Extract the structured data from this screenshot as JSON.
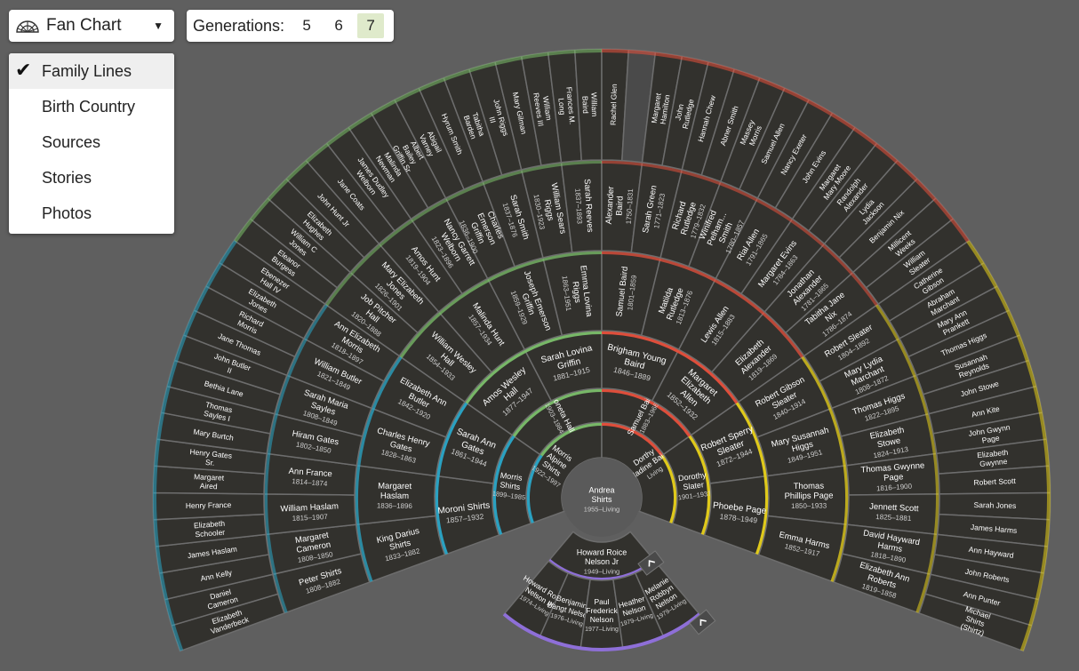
{
  "toolbar": {
    "chart_type": "Fan Chart",
    "generations_label": "Generations:",
    "generations": [
      "5",
      "6",
      "7"
    ],
    "selected_generation": "7"
  },
  "view_menu": {
    "items": [
      "Family Lines",
      "Birth Country",
      "Sources",
      "Stories",
      "Photos"
    ],
    "selected": "Family Lines"
  },
  "colors": {
    "background": "#5f5f5f",
    "slice": "#32312d",
    "paternal_paternal": "#7bbf6a",
    "paternal_maternal": "#2aa8c9",
    "maternal_paternal": "#e8503c",
    "maternal_maternal": "#e9d21a",
    "descendants": "#8e6fd8"
  },
  "focus_person": {
    "name": "Andrea Shirts",
    "dates": "1955–Living"
  },
  "ancestors": {
    "gen1": [
      {
        "name": "Morris Alpine Shirts",
        "dates": "1922–1997"
      },
      {
        "name": "Dorthy Madine Baird",
        "dates": "Living"
      }
    ],
    "gen2": [
      {
        "name": "Morris Shirts",
        "dates": "1899–1985"
      },
      {
        "name": "Loneta Hall",
        "dates": "1903–1984"
      },
      {
        "name": "Samuel Baird",
        "dates": "1883–1966"
      },
      {
        "name": "Dorothy Slater",
        "dates": "1901–1937"
      }
    ],
    "gen3": [
      {
        "name": "Moroni Shirts",
        "dates": "1857–1932"
      },
      {
        "name": "Sarah Ann Gates",
        "dates": "1861–1944"
      },
      {
        "name": "Amos Wesley Hall",
        "dates": "1877–1947"
      },
      {
        "name": "Sarah Lovina Griffin",
        "dates": "1881–1915"
      },
      {
        "name": "Brigham Young Baird",
        "dates": "1846–1889"
      },
      {
        "name": "Margaret Elizabeth Allen",
        "dates": "1852–1932"
      },
      {
        "name": "Robert Sperry Sleater",
        "dates": "1872–1944"
      },
      {
        "name": "Phoebe Page",
        "dates": "1878–1949"
      }
    ],
    "gen4": [
      {
        "name": "King Darius Shirts",
        "dates": "1833–1882"
      },
      {
        "name": "Margaret Haslam",
        "dates": "1836–1896"
      },
      {
        "name": "Charles Henry Gates",
        "dates": "1828–1863"
      },
      {
        "name": "Elizabeth Ann Butler",
        "dates": "1842–1920"
      },
      {
        "name": "William Wesley Hall",
        "dates": "1854–1933"
      },
      {
        "name": "Malinda Hunt",
        "dates": "1857–1934"
      },
      {
        "name": "Joseph Emerson Griffin",
        "dates": "1859–1929"
      },
      {
        "name": "Emma Lovina Riggs",
        "dates": "1863–1951"
      },
      {
        "name": "Samuel Baird",
        "dates": "1801–1859"
      },
      {
        "name": "Matilda Rutledge",
        "dates": "1813–1876"
      },
      {
        "name": "Lewis Allen",
        "dates": "1815–1883"
      },
      {
        "name": "Elizabeth Alexander",
        "dates": "1819–1869"
      },
      {
        "name": "Robert Gibson Sleater",
        "dates": "1840–1914"
      },
      {
        "name": "Mary Susannah Higgs",
        "dates": "1849–1951"
      },
      {
        "name": "Thomas Phillips Page",
        "dates": "1850–1933"
      },
      {
        "name": "Emma Harms",
        "dates": "1852–1917"
      }
    ],
    "gen5": [
      {
        "name": "Peter Shirts",
        "dates": "1808–1882"
      },
      {
        "name": "Margaret Cameron",
        "dates": "1808–1850"
      },
      {
        "name": "William Haslam",
        "dates": "1815–1907"
      },
      {
        "name": "Ann France",
        "dates": "1814–1874"
      },
      {
        "name": "Hiram Gates",
        "dates": "1802–1850"
      },
      {
        "name": "Sarah Maria Sayles",
        "dates": "1808–1849"
      },
      {
        "name": "William Butler",
        "dates": "1821–1849"
      },
      {
        "name": "Ann Elizabeth Morris",
        "dates": "1818–1897"
      },
      {
        "name": "Job Pitcher Hall",
        "dates": "1820–1888"
      },
      {
        "name": "Mary Elizabeth Jones",
        "dates": "1826–1901"
      },
      {
        "name": "Amos Hunt",
        "dates": "1819–1904"
      },
      {
        "name": "Nancy Garrett Welborn",
        "dates": "1823–1896"
      },
      {
        "name": "Charles Emerson Griffin",
        "dates": "1836–1900"
      },
      {
        "name": "Sarah Smith",
        "dates": "1837–1876"
      },
      {
        "name": "William Sears Riggs",
        "dates": "1830–1923"
      },
      {
        "name": "Sarah Reeves",
        "dates": "1837–1893"
      },
      {
        "name": "Alexander Baird",
        "dates": "1750–1831"
      },
      {
        "name": "Sarah Green",
        "dates": "1771–1823"
      },
      {
        "name": "Richard Rutledge",
        "dates": "1779–1832"
      },
      {
        "name": "Winifred Pelham... Smith",
        "dates": "1780–1857"
      },
      {
        "name": "Rial Allen",
        "dates": "1791–1865"
      },
      {
        "name": "Margaret Evins",
        "dates": "1784–1863"
      },
      {
        "name": "Jonathan Alexander",
        "dates": "1781–1865"
      },
      {
        "name": "Tabitha Jane Nix",
        "dates": "1786–1874"
      },
      {
        "name": "Robert Sleater",
        "dates": "1804–1892"
      },
      {
        "name": "Mary Lydia Marchant",
        "dates": "1808–1872"
      },
      {
        "name": "Thomas Higgs",
        "dates": "1822–1895"
      },
      {
        "name": "Elizabeth Stowe",
        "dates": "1824–1913"
      },
      {
        "name": "Thomas Gwynne Page",
        "dates": "1816–1900"
      },
      {
        "name": "Jennett Scott",
        "dates": "1825–1881"
      },
      {
        "name": "David Hayward Harms",
        "dates": "1818–1890"
      },
      {
        "name": "Elizabeth Ann Roberts",
        "dates": "1819–1858"
      }
    ],
    "gen6": [
      {
        "name": "Elizabeth Vanderbeck"
      },
      {
        "name": "Daniel Cameron"
      },
      {
        "name": "Ann Kelly"
      },
      {
        "name": "James Haslam"
      },
      {
        "name": "Elizabeth Schooler"
      },
      {
        "name": "Henry France"
      },
      {
        "name": "Margaret Aired"
      },
      {
        "name": "Henry Gates Sr."
      },
      {
        "name": "Mary Burtch"
      },
      {
        "name": "Thomas Sayles I"
      },
      {
        "name": "Bethia Lane"
      },
      {
        "name": "John Butler II"
      },
      {
        "name": "Jane Thomas"
      },
      {
        "name": "Richard Morris"
      },
      {
        "name": "Elizabeth Jones"
      },
      {
        "name": "Ebenezer Hall IV"
      },
      {
        "name": "Eleanor Burgess"
      },
      {
        "name": "William C Jones"
      },
      {
        "name": "Elizabeth Hughes"
      },
      {
        "name": "John Hunt Jr"
      },
      {
        "name": "Jane Coats"
      },
      {
        "name": "James Dudley Welborn"
      },
      {
        "name": "Malinda Newman"
      },
      {
        "name": "Albert Bailey Griffin Sr"
      },
      {
        "name": "Abigail Varney"
      },
      {
        "name": "Hyrum Smith"
      },
      {
        "name": "Tabitha Barden"
      },
      {
        "name": "John Riggs III"
      },
      {
        "name": "Mary Gilman"
      },
      {
        "name": "William Reeves III"
      },
      {
        "name": "Frances M. Long"
      },
      {
        "name": "William Baird"
      },
      {
        "name": "Rachel Glen"
      },
      {
        "name": ""
      },
      {
        "name": "Margaret Hamilton"
      },
      {
        "name": "John Rutledge"
      },
      {
        "name": "Hannah Chew"
      },
      {
        "name": "Abner Smith"
      },
      {
        "name": "Massey Morris"
      },
      {
        "name": "Samuel Allen"
      },
      {
        "name": "Nancy Exeter"
      },
      {
        "name": "John Evins"
      },
      {
        "name": "Margaret Mary Moore"
      },
      {
        "name": "Randolph Alexander"
      },
      {
        "name": "Lydia Jackson"
      },
      {
        "name": "Benjamin Nix"
      },
      {
        "name": "Millicent Weeks"
      },
      {
        "name": "William Sleater"
      },
      {
        "name": "Catherine Gibson"
      },
      {
        "name": "Abraham Marchant"
      },
      {
        "name": "Mary Ann Prankett"
      },
      {
        "name": "Thomas Higgs"
      },
      {
        "name": "Susannah Reynolds"
      },
      {
        "name": "John Stowe"
      },
      {
        "name": "Ann Kite"
      },
      {
        "name": "John Gwynn Page"
      },
      {
        "name": "Elizabeth Gwynne"
      },
      {
        "name": "Robert Scott"
      },
      {
        "name": "Sarah Jones"
      },
      {
        "name": "James Harms"
      },
      {
        "name": "Ann Hayward"
      },
      {
        "name": "John Roberts"
      },
      {
        "name": "Ann Punter"
      },
      {
        "name": "Michael Shirts (Shirtz)"
      }
    ]
  },
  "descendants": {
    "children": [
      {
        "name": "Howard Roice Nelson Jr",
        "dates": "1949–Living"
      }
    ],
    "grandchildren": [
      {
        "name": "Howard Roice Nelson III",
        "dates": "1974–Living"
      },
      {
        "name": "Benjamin Bangt Nelson",
        "dates": "1976–Living"
      },
      {
        "name": "Paul Frederick Nelson",
        "dates": "1977–Living"
      },
      {
        "name": "Heather Nelson",
        "dates": "1979–Living"
      },
      {
        "name": "Melanie Robbyn Nelson",
        "dates": "1979–Living"
      }
    ]
  }
}
